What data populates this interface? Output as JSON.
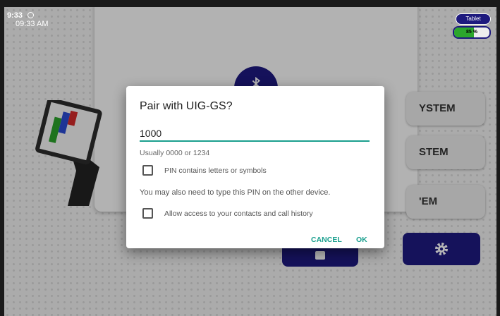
{
  "status_bar": {
    "time": "9:33",
    "clock": "09:33 AM"
  },
  "device": {
    "label": "Tablet",
    "battery_text": "85 %",
    "battery_level": 0.55
  },
  "background": {
    "system_buttons": [
      "YSTEM",
      "STEM",
      "'EM"
    ],
    "bluetooth_icon": "bluetooth-icon",
    "camera_icon": "camera-icon",
    "settings_icon": "gear-icon"
  },
  "dialog": {
    "title": "Pair with UIG-GS?",
    "pin_value": "1000",
    "hint": "Usually 0000 or 1234",
    "checkbox_letters": "PIN contains letters or symbols",
    "note": "You may also need to type this PIN on the other device.",
    "checkbox_contacts": "Allow access to your contacts and call history",
    "cancel_label": "CANCEL",
    "ok_label": "OK"
  },
  "colors": {
    "accent": "#1a9f8e",
    "brand": "#1e1a7e",
    "battery": "#2ca62c"
  }
}
